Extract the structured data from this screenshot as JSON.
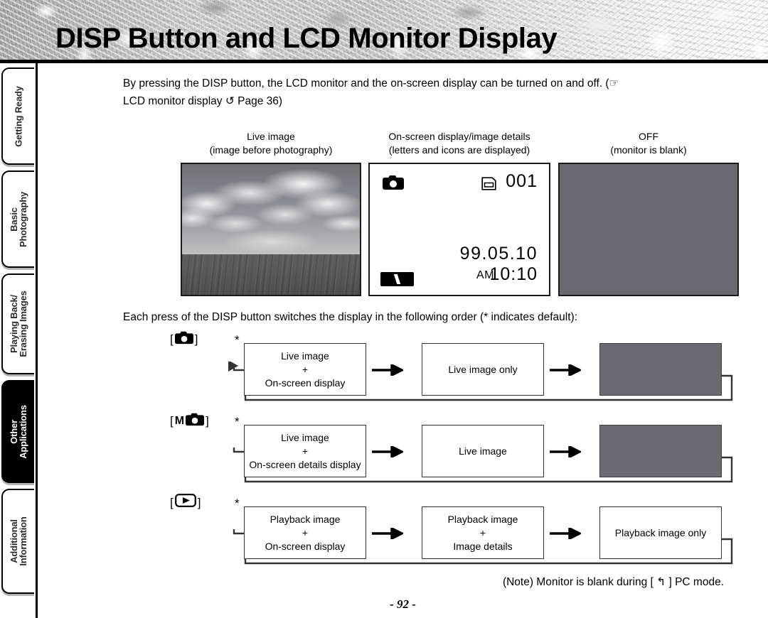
{
  "header": {
    "title": "DISP Button and LCD Monitor Display"
  },
  "sidebar": {
    "tabs": [
      {
        "label": "Getting Ready",
        "active": false
      },
      {
        "label": "Basic\nPhotography",
        "line1": "Basic",
        "line2": "Photography",
        "active": false
      },
      {
        "label": "Playing Back/\nErasing Images",
        "line1": "Playing Back/",
        "line2": "Erasing Images",
        "active": false
      },
      {
        "label": "Other\nApplications",
        "line1": "Other",
        "line2": "Applications",
        "active": true
      },
      {
        "label": "Additional\nInformation",
        "line1": "Additional",
        "line2": "Information",
        "active": false
      }
    ]
  },
  "content": {
    "intro_line1": "By pressing the DISP button, the LCD monitor and the on-screen display can be turned on and off. (☞",
    "intro_line2": "LCD monitor display ↺ Page 36)",
    "order_text": "Each press of the DISP button switches the display in the following order (* indicates default):",
    "note_text": "(Note) Monitor is blank during [ ↰ ] PC mode.",
    "page_number": "- 92 -"
  },
  "panels": [
    {
      "caption_line1": "Live image",
      "caption_line2": "(image before photography)",
      "kind": "photo"
    },
    {
      "caption_line1": "On-screen display/image details",
      "caption_line2": "(letters and icons are displayed)",
      "kind": "osd"
    },
    {
      "caption_line1": "OFF",
      "caption_line2": "(monitor is blank)",
      "kind": "off"
    }
  ],
  "osd": {
    "camera_icon": "camera-icon",
    "card_icon": "memory-card-icon",
    "frame_count": "001",
    "date": "99.05.10",
    "ampm": "AM",
    "time": "10:10",
    "battery_icon": "battery-icon"
  },
  "flows": [
    {
      "mode_icon": "camera-icon",
      "mode_prefix": "",
      "star": "*",
      "boxes": [
        {
          "line1": "Live image",
          "line2": "+",
          "line3": "On-screen display",
          "gray": false
        },
        {
          "line1": "Live image only",
          "line2": "",
          "line3": "",
          "gray": false
        },
        {
          "line1": "",
          "line2": "",
          "line3": "",
          "gray": true
        }
      ]
    },
    {
      "mode_icon": "camera-icon",
      "mode_prefix": "M",
      "star": "*",
      "boxes": [
        {
          "line1": "Live image",
          "line2": "+",
          "line3": "On-screen details display",
          "gray": false
        },
        {
          "line1": "Live image",
          "line2": "",
          "line3": "",
          "gray": false
        },
        {
          "line1": "",
          "line2": "",
          "line3": "",
          "gray": true
        }
      ]
    },
    {
      "mode_icon": "playback-icon",
      "mode_prefix": "",
      "star": "*",
      "boxes": [
        {
          "line1": "Playback image",
          "line2": "+",
          "line3": "On-screen display",
          "gray": false
        },
        {
          "line1": "Playback image",
          "line2": "+",
          "line3": "Image details",
          "gray": false
        },
        {
          "line1": "Playback image only",
          "line2": "",
          "line3": "",
          "gray": false
        }
      ]
    }
  ],
  "colors": {
    "gray_panel": "#6a6a70",
    "rule": "#000000",
    "active_tab_bg": "#000000",
    "active_tab_text": "#ffffff"
  }
}
